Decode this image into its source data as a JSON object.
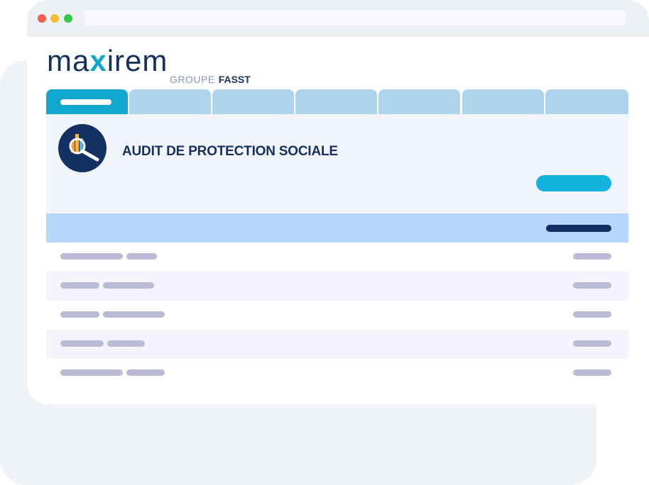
{
  "colors": {
    "accent": "#12a7cf",
    "navy": "#14305b",
    "tab_inactive": "#aed3ec",
    "table_header": "#b6d7fa",
    "placeholder": "#bbbad5"
  },
  "window": {
    "controls": [
      "close",
      "minimize",
      "maximize"
    ]
  },
  "logo": {
    "pre": "ma",
    "x": "x",
    "post": "irem",
    "group_label": "GROUPE",
    "group_name": "FASST"
  },
  "tabs": {
    "count": 7,
    "active_index": 0
  },
  "header": {
    "icon": "audit-magnifier-chart-icon",
    "title": "AUDIT DE PROTECTION SOCIALE"
  }
}
